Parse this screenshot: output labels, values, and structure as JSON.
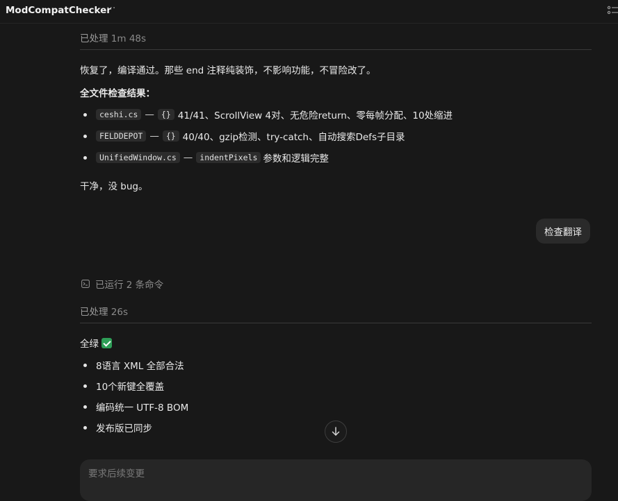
{
  "titlebar": {
    "title": "ModCompatChecker",
    "more_icon": "ellipsis-icon",
    "panel_icon": "panel-list-icon"
  },
  "block1": {
    "processed_label": "已处理",
    "processed_time": "1m 48s",
    "summary": "恢复了，编译通过。那些 end 注释纯装饰，不影响功能，不冒险改了。",
    "heading": "全文件检查结果：",
    "items": [
      {
        "file": "ceshi.cs",
        "sep": "—",
        "tag": "{}",
        "desc": "41/41、ScrollView 4对、无危险return、零每帧分配、10处缩进"
      },
      {
        "file": "FELDDEPOT",
        "sep": "—",
        "tag": "{}",
        "desc": "40/40、gzip检测、try-catch、自动搜索Defs子目录"
      },
      {
        "file": "UnifiedWindow.cs",
        "sep": "—",
        "tag": "indentPixels",
        "desc": "参数和逻辑完整"
      }
    ],
    "footer": "干净，没 bug。"
  },
  "user_message": "检查翻译",
  "ran_commands": "已运行 2 条命令",
  "block2": {
    "processed_label": "已处理",
    "processed_time": "26s",
    "heading": "全绿",
    "items": [
      "8语言 XML 全部合法",
      "10个新键全覆盖",
      "编码统一 UTF-8 BOM",
      "发布版已同步"
    ]
  },
  "composer": {
    "placeholder": "要求后续变更"
  },
  "colors": {
    "background": "#181818",
    "bubble": "#2a2a2a",
    "check": "#2e9e57"
  }
}
